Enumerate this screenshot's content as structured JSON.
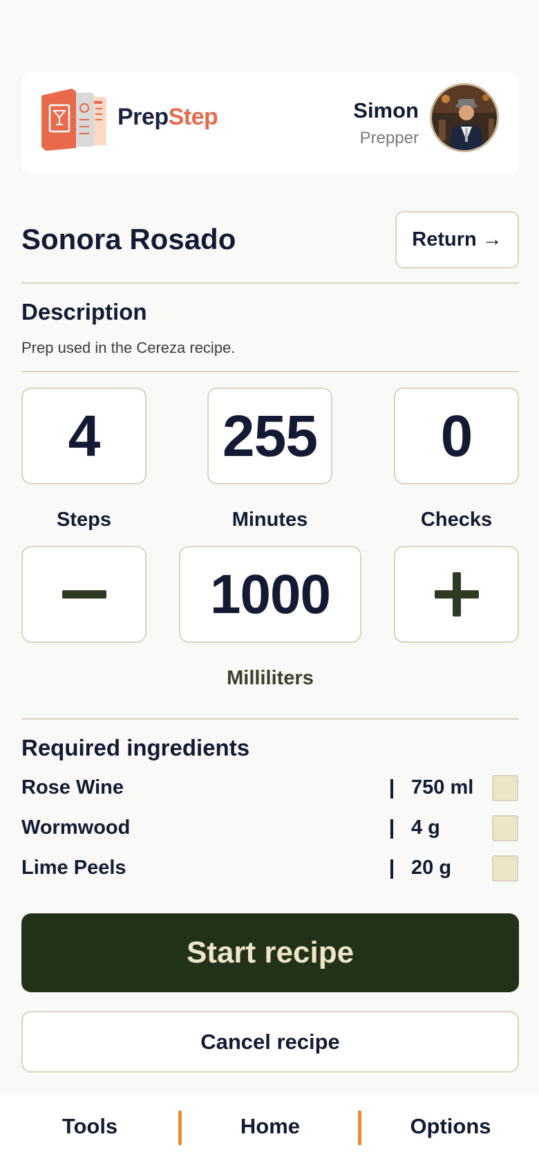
{
  "header": {
    "brand_prep": "Prep",
    "brand_step": "Step",
    "user_name": "Simon",
    "user_role": "Prepper",
    "accent": "#e86a4a"
  },
  "recipe": {
    "title": "Sonora Rosado",
    "return_label": "Return →",
    "description_heading": "Description",
    "description": "Prep used in the Cereza recipe."
  },
  "stats": [
    {
      "value": "4",
      "label": "Steps"
    },
    {
      "value": "255",
      "label": "Minutes"
    },
    {
      "value": "0",
      "label": "Checks"
    }
  ],
  "quantity": {
    "minus_label": "—",
    "value": "1000",
    "plus_label": "+",
    "unit": "Milliliters"
  },
  "ingredients": {
    "heading": "Required ingredients",
    "items": [
      {
        "name": "Rose Wine",
        "qty": "750 ml",
        "checked": false
      },
      {
        "name": "Wormwood",
        "qty": "4 g",
        "checked": false
      },
      {
        "name": "Lime Peels",
        "qty": "20 g",
        "checked": false
      }
    ]
  },
  "actions": {
    "start": "Start recipe",
    "cancel": "Cancel recipe"
  },
  "nav": {
    "items": [
      "Tools",
      "Home",
      "Options"
    ],
    "separator_color": "#e88a2d"
  },
  "colors": {
    "primary_dark": "#223219",
    "cream": "#ece5c8",
    "border": "#d9d4bf",
    "text": "#131a33"
  }
}
